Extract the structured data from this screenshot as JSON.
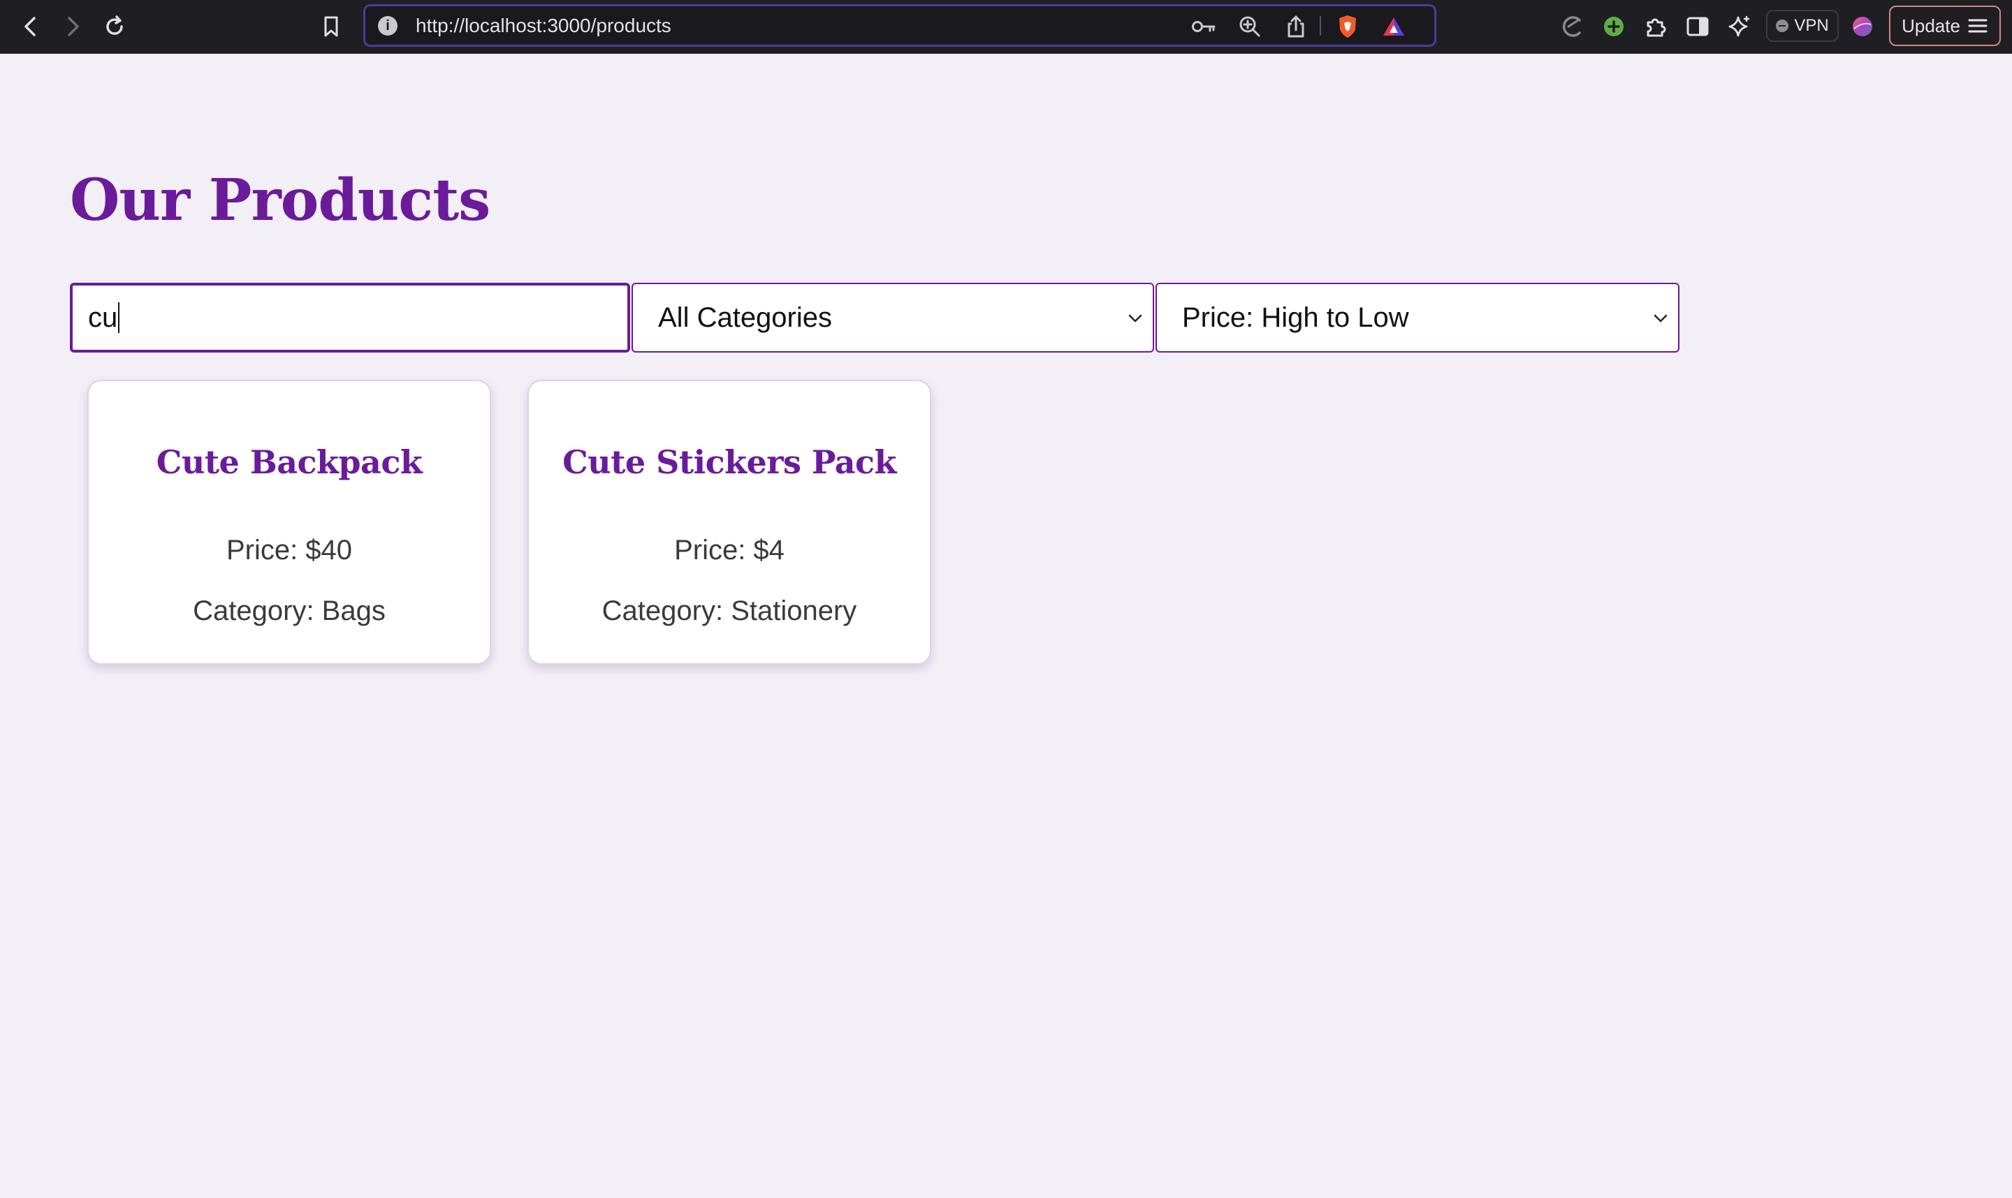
{
  "browser": {
    "url": "http://localhost:3000/products",
    "info_icon": "i",
    "vpn_label": "VPN",
    "update_label": "Update",
    "icons": {
      "back": "chevron-left-icon",
      "forward": "chevron-right-icon",
      "reload": "reload-icon",
      "bookmark": "bookmark-icon",
      "password": "key-icon",
      "zoom": "zoom-in-icon",
      "share": "share-icon",
      "shields": "brave-shield-icon",
      "rewards": "brave-rewards-icon",
      "leo": "leo-icon",
      "extension_add": "plus-circle-icon",
      "extensions": "puzzle-icon",
      "sidebar": "sidebar-icon",
      "ai": "sparkle-icon",
      "wallet": "wallet-icon",
      "menu": "hamburger-icon"
    }
  },
  "page": {
    "title": "Our Products",
    "search": {
      "value": "cu"
    },
    "category_select": {
      "selected": "All Categories"
    },
    "sort_select": {
      "selected": "Price: High to Low"
    },
    "products": [
      {
        "name": "Cute Backpack",
        "price": "Price: $40",
        "category": "Category: Bags"
      },
      {
        "name": "Cute Stickers Pack",
        "price": "Price: $4",
        "category": "Category: Stationery"
      }
    ]
  },
  "colors": {
    "accent": "#6a1b9a",
    "page_bg": "#f3eff7",
    "chrome_bg": "#1f1f23"
  }
}
